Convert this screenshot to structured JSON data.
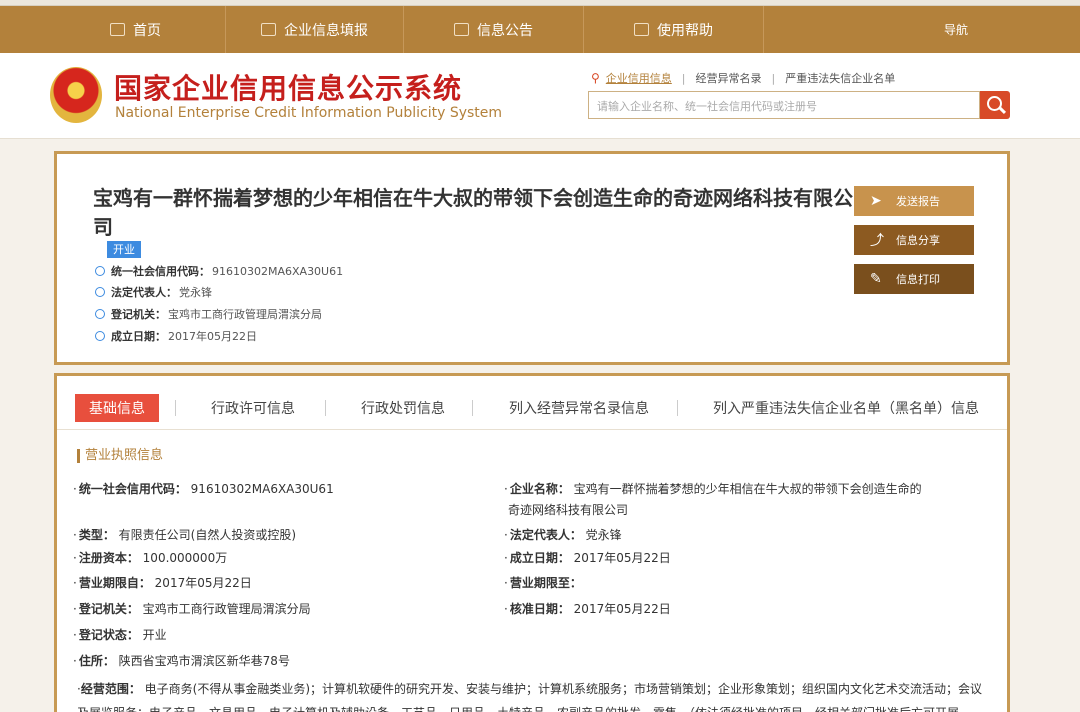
{
  "nav": {
    "items": [
      "首页",
      "企业信息填报",
      "信息公告",
      "使用帮助"
    ],
    "right": "导航"
  },
  "header": {
    "logo_cn": "国家企业信用信息公示系统",
    "logo_en": "National Enterprise Credit Information Publicity System",
    "search_links": [
      "企业信用信息",
      "经营异常名录",
      "严重违法失信企业名单"
    ],
    "search_placeholder": "请输入企业名称、统一社会信用代码或注册号"
  },
  "company": {
    "name": "宝鸡有一群怀揣着梦想的少年相信在牛大叔的带领下会创造生命的奇迹网络科技有限公司",
    "status": "开业",
    "lines": [
      {
        "label": "统一社会信用代码：",
        "value": "91610302MA6XA30U61"
      },
      {
        "label": "法定代表人：",
        "value": "党永锋"
      },
      {
        "label": "登记机关：",
        "value": "宝鸡市工商行政管理局渭滨分局"
      },
      {
        "label": "成立日期：",
        "value": "2017年05月22日"
      }
    ],
    "actions": [
      "发送报告",
      "信息分享",
      "信息打印"
    ]
  },
  "tabs": [
    "基础信息",
    "行政许可信息",
    "行政处罚信息",
    "列入经营异常名录信息",
    "列入严重违法失信企业名单（黑名单）信息"
  ],
  "license": {
    "section_title": "营业执照信息",
    "left": [
      {
        "label": "统一社会信用代码：",
        "value": "91610302MA6XA30U61"
      },
      {
        "label": "类型：",
        "value": "有限责任公司(自然人投资或控股)"
      },
      {
        "label": "注册资本：",
        "value": "100.000000万"
      },
      {
        "label": "营业期限自：",
        "value": "2017年05月22日"
      },
      {
        "label": "登记机关：",
        "value": "宝鸡市工商行政管理局渭滨分局"
      },
      {
        "label": "登记状态：",
        "value": "开业"
      },
      {
        "label": "住所：",
        "value": "陕西省宝鸡市渭滨区新华巷78号"
      }
    ],
    "right": [
      {
        "label": "企业名称：",
        "value": "宝鸡有一群怀揣着梦想的少年相信在牛大叔的带领下会创造生命的",
        "value2": "奇迹网络科技有限公司"
      },
      {
        "label": "法定代表人：",
        "value": "党永锋"
      },
      {
        "label": "成立日期：",
        "value": "2017年05月22日"
      },
      {
        "label": "营业期限至：",
        "value": ""
      },
      {
        "label": "核准日期：",
        "value": "2017年05月22日"
      }
    ],
    "scope_label": "经营范围：",
    "scope_text": "电子商务(不得从事金融类业务)；计算机软硬件的研究开发、安装与维护；计算机系统服务；市场营销策划；企业形象策划；组织国内文化艺术交流活动；会议及展览服务；电子产品、文具用品、电子计算机及辅助设备、工艺品、日用品、土特产品、农副产品的批发、零售。（依法须经批准的项目，经相关部门批准后方可开展"
  }
}
